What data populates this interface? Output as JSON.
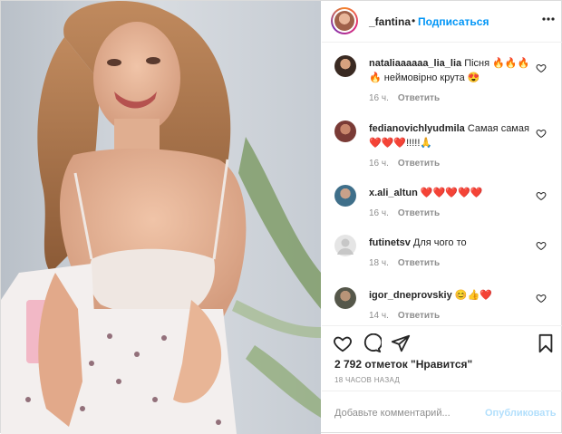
{
  "header": {
    "username": "_fantina",
    "separator": "•",
    "follow_label": "Подписаться"
  },
  "comments": [
    {
      "username": "nataliaaaaaa_lia_lia",
      "text": "Пісня",
      "emoji_a": "🔥🔥🔥",
      "text2": "неймовірно крута",
      "emoji_b": "😍",
      "emoji_c": "🔥",
      "time": "16 ч.",
      "reply": "Ответить"
    },
    {
      "username": "fedianovichlyudmila",
      "text": "Самая самая",
      "emoji_a": "❤️❤️❤️",
      "text2": "!!!!!",
      "emoji_b": "🙏",
      "time": "16 ч.",
      "reply": "Ответить"
    },
    {
      "username": "x.ali_altun",
      "emoji_a": "❤️❤️❤️❤️❤️",
      "time": "16 ч.",
      "reply": "Ответить"
    },
    {
      "username": "futinetsv",
      "text": "Для чого то",
      "time": "18 ч.",
      "reply": "Ответить"
    },
    {
      "username": "igor_dneprovskiy",
      "emoji_a": "😊👍❤️",
      "time": "14 ч.",
      "reply": "Ответить"
    }
  ],
  "likes": "2 792 отметок \"Нравится\"",
  "posted_ago": "18 ЧАСОВ НАЗАД",
  "composer": {
    "placeholder": "Добавьте комментарий...",
    "publish_label": "Опубликовать"
  },
  "icons": [
    "more-icon",
    "heart-icon",
    "comment-icon",
    "share-icon",
    "bookmark-icon"
  ],
  "colors": {
    "accent": "#0095f6",
    "muted": "#8e8e8e",
    "publish_disabled": "#b2dffc"
  }
}
